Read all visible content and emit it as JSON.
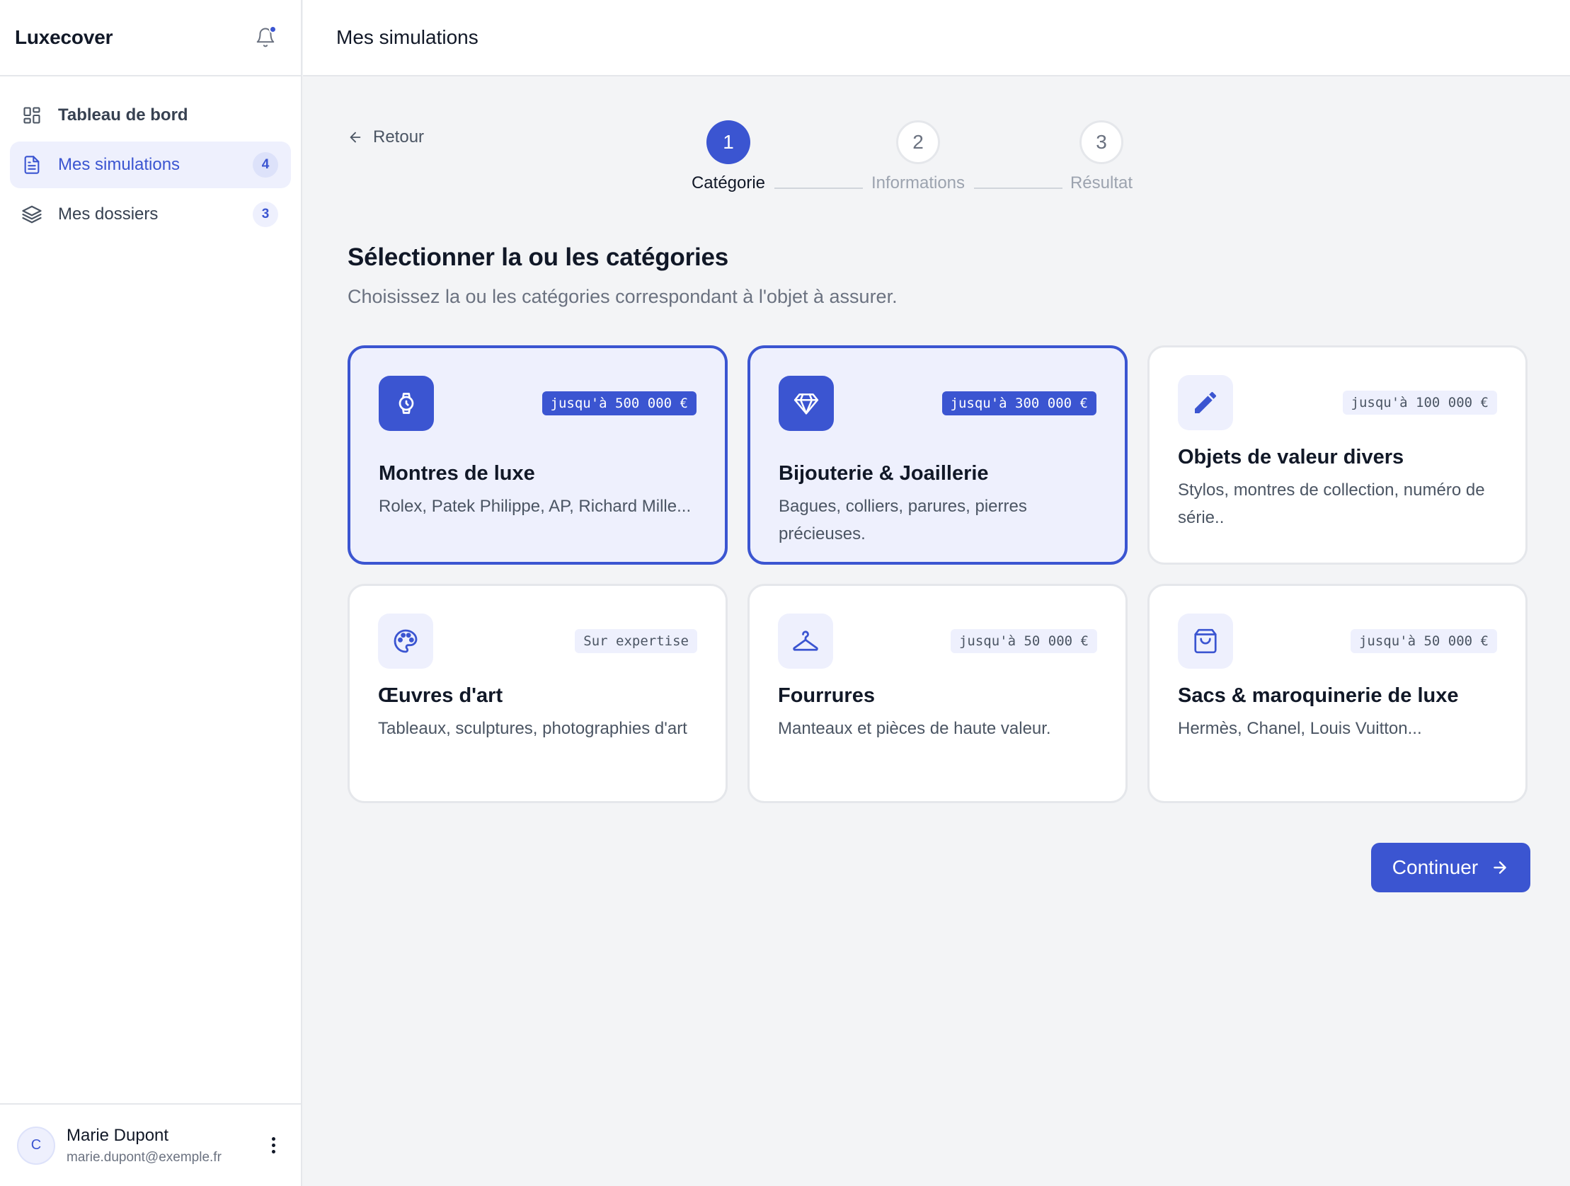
{
  "app": {
    "brand": "Luxecover",
    "notification_has_unread": true
  },
  "sidebar": {
    "items": [
      {
        "label": "Tableau de bord",
        "icon": "grid-icon",
        "badge": ""
      },
      {
        "label": "Mes simulations",
        "icon": "document-icon",
        "badge": "4",
        "active": true
      },
      {
        "label": "Mes dossiers",
        "icon": "layers-icon",
        "badge": "3"
      }
    ],
    "user": {
      "initial": "C",
      "name": "Marie Dupont",
      "email": "marie.dupont@exemple.fr"
    }
  },
  "header": {
    "title": "Mes simulations"
  },
  "main": {
    "back_label": "Retour",
    "steps": [
      {
        "number": "1",
        "label": "Catégorie",
        "state": "current"
      },
      {
        "number": "2",
        "label": "Informations",
        "state": "todo"
      },
      {
        "number": "3",
        "label": "Résultat",
        "state": "todo"
      }
    ],
    "section_title": "Sélectionner la ou les catégories",
    "section_subtitle": "Choisissez la ou les catégories correspondant à l'objet à assurer.",
    "categories": [
      {
        "title": "Montres de luxe",
        "description": "Rolex, Patek Philippe, AP, Richard Mille...",
        "limit": "jusqu'à 500 000 €",
        "icon": "watch-icon",
        "selected": true
      },
      {
        "title": "Bijouterie & Joaillerie",
        "description": "Bagues, colliers, parures, pierres précieuses.",
        "limit": "jusqu'à 300 000 €",
        "icon": "diamond-icon",
        "selected": true
      },
      {
        "title": "Objets de valeur divers",
        "description": "Stylos, montres de collection, numéro de série..",
        "limit": "jusqu'à 100 000 €",
        "icon": "pen-icon",
        "selected": false
      },
      {
        "title": "Œuvres d'art",
        "description": "Tableaux, sculptures, photographies d'art",
        "limit": "Sur expertise",
        "icon": "palette-icon",
        "selected": false
      },
      {
        "title": "Fourrures",
        "description": "Manteaux et pièces de haute valeur.",
        "limit": "jusqu'à 50 000 €",
        "icon": "hanger-icon",
        "selected": false
      },
      {
        "title": "Sacs & maroquinerie de luxe",
        "description": "Hermès, Chanel, Louis Vuitton...",
        "limit": "jusqu'à 50 000 €",
        "icon": "bag-icon",
        "selected": false
      }
    ],
    "continue_label": "Continuer"
  },
  "colors": {
    "accent": "#3b55d1",
    "accent_soft": "#eef0fd",
    "background": "#f3f4f6"
  }
}
